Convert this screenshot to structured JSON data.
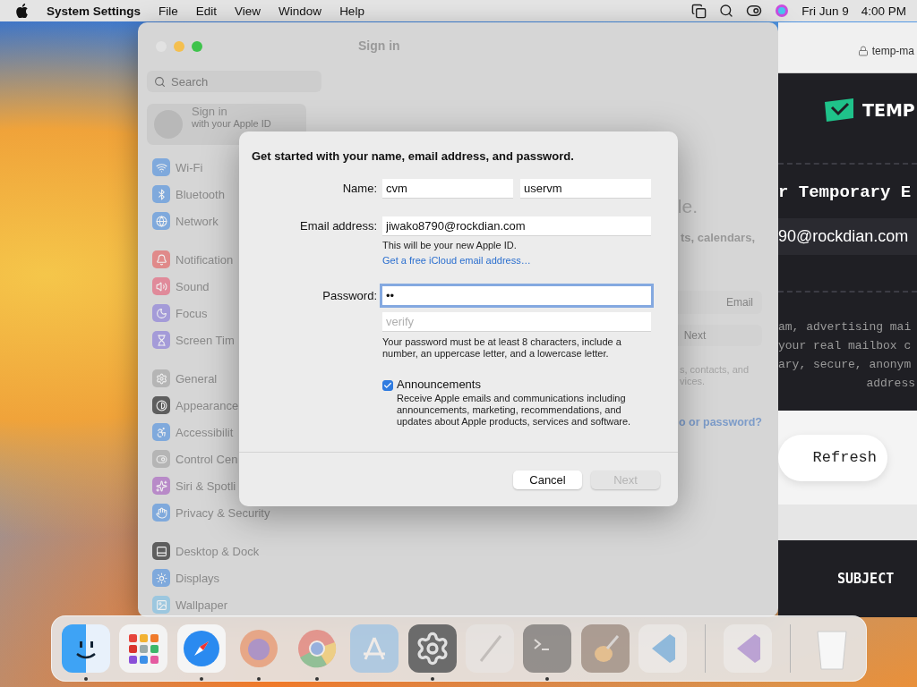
{
  "menu_bar": {
    "app_name": "System Settings",
    "menus": [
      "File",
      "Edit",
      "View",
      "Window",
      "Help"
    ],
    "date": "Fri Jun 9",
    "time": "4:00 PM"
  },
  "settings_window": {
    "title": "Sign in",
    "search": {
      "placeholder": "Search"
    },
    "account": {
      "title": "Sign in",
      "subtitle": "with your Apple ID"
    },
    "sidebar_groups": [
      [
        {
          "label": "Wi-Fi",
          "kind": "wifi",
          "color": "#7fa9dc"
        },
        {
          "label": "Bluetooth",
          "kind": "bluetooth",
          "color": "#7fa9dc"
        },
        {
          "label": "Network",
          "kind": "network",
          "color": "#7fa9dc"
        }
      ],
      [
        {
          "label": "Notification",
          "kind": "bell",
          "color": "#e08a8a"
        },
        {
          "label": "Sound",
          "kind": "sound",
          "color": "#e08a9a"
        },
        {
          "label": "Focus",
          "kind": "moon",
          "color": "#a49bd8"
        },
        {
          "label": "Screen Tim",
          "kind": "hourglass",
          "color": "#a49bd8"
        }
      ],
      [
        {
          "label": "General",
          "kind": "gear",
          "color": "#b5b5b5"
        },
        {
          "label": "Appearance",
          "kind": "contrast",
          "color": "#5e5e5e"
        },
        {
          "label": "Accessibilit",
          "kind": "accessibility",
          "color": "#7fa9dc"
        },
        {
          "label": "Control Cen",
          "kind": "toggle",
          "color": "#b5b5b5"
        },
        {
          "label": "Siri & Spotli",
          "kind": "sparkle",
          "color": "#b88ac8"
        },
        {
          "label": "Privacy & Security",
          "kind": "hand",
          "color": "#7fa9dc"
        }
      ],
      [
        {
          "label": "Desktop & Dock",
          "kind": "dock",
          "color": "#5e5e5e"
        },
        {
          "label": "Displays",
          "kind": "sun",
          "color": "#7fa9dc"
        },
        {
          "label": "Wallpaper",
          "kind": "image",
          "color": "#9cc7df"
        }
      ]
    ],
    "pane_fragments": [
      {
        "kind": "heading",
        "text": "le."
      },
      {
        "kind": "bold",
        "text": "ts, calendars,"
      },
      {
        "kind": "field",
        "placeholder": "Email"
      },
      {
        "kind": "button",
        "text": "Next"
      },
      {
        "kind": "text",
        "text": "s, contacts, and"
      },
      {
        "kind": "text",
        "text": "vices."
      },
      {
        "kind": "link",
        "text": "o or password?"
      }
    ]
  },
  "dialog": {
    "heading": "Get started with your name, email address, and password.",
    "name": {
      "label": "Name:",
      "first": "cvm",
      "last": "uservm"
    },
    "email": {
      "label": "Email address:",
      "value": "jiwako8790@rockdian.com",
      "note": "This will be your new Apple ID.",
      "link": "Get a free iCloud email address…"
    },
    "password": {
      "label": "Password:",
      "value": "••",
      "focused": true,
      "verify_placeholder": "verify",
      "hint": "Your password must be at least 8 characters, include a number, an uppercase letter, and a lowercase letter."
    },
    "announcements": {
      "label": "Announcements",
      "checked": true,
      "description": "Receive Apple emails and communications including announcements, marketing, recommendations, and updates about Apple products, services and software."
    },
    "buttons": [
      {
        "label": "Cancel",
        "disabled": false
      },
      {
        "label": "Next",
        "disabled": true
      }
    ]
  },
  "browser": {
    "url": "temp-ma",
    "logo": "TEMP",
    "title": "r Temporary E",
    "address": "90@rockdian.com",
    "paragraph": [
      "am, advertising mai",
      "your real mailbox c",
      "ary, secure, anonym",
      "address"
    ],
    "refresh": "Refresh",
    "column": "SUBJECT"
  },
  "dock": {
    "items": [
      {
        "kind": "finder",
        "running": true
      },
      {
        "kind": "launchpad",
        "running": false
      },
      {
        "kind": "safari",
        "running": true
      },
      {
        "kind": "firefox",
        "running": true
      },
      {
        "kind": "chrome",
        "running": true
      },
      {
        "kind": "appstore",
        "running": false
      },
      {
        "kind": "settings",
        "running": true
      },
      {
        "kind": "pen",
        "running": false
      },
      {
        "kind": "terminal",
        "running": true
      },
      {
        "kind": "guitar",
        "running": false
      },
      {
        "kind": "vscode",
        "running": false
      },
      {
        "kind": "separator"
      },
      {
        "kind": "visualstudio",
        "running": false
      },
      {
        "kind": "separator"
      },
      {
        "kind": "trash",
        "running": false
      }
    ]
  }
}
